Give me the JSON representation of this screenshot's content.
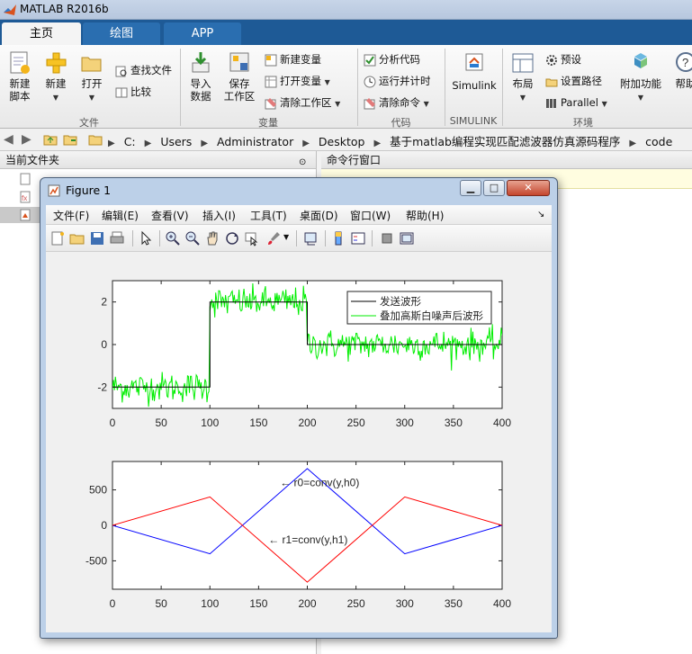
{
  "app": {
    "title": "MATLAB R2016b"
  },
  "tabs": [
    {
      "label": "主页",
      "active": true
    },
    {
      "label": "绘图",
      "active": false
    },
    {
      "label": "APP",
      "active": false
    }
  ],
  "ribbon": {
    "file": {
      "new_script": "新建\n脚本",
      "new": "新建",
      "open": "打开",
      "find_files": "查找文件",
      "compare": "比较",
      "group": "文件"
    },
    "variable": {
      "import": "导入\n数据",
      "save_ws": "保存\n工作区",
      "new_var": "新建变量",
      "open_var": "打开变量",
      "clear_ws": "清除工作区",
      "group": "变量"
    },
    "code": {
      "analyze": "分析代码",
      "run_time": "运行并计时",
      "clear_cmd": "清除命令",
      "group": "代码"
    },
    "simulink": {
      "label": "Simulink",
      "group": "SIMULINK"
    },
    "env": {
      "layout": "布局",
      "prefs": "预设",
      "set_path": "设置路径",
      "parallel": "Parallel",
      "addons": "附加功能",
      "help": "帮助",
      "group": "环境"
    }
  },
  "address": {
    "crumbs": [
      "C:",
      "Users",
      "Administrator",
      "Desktop",
      "基于matlab编程实现匹配滤波器仿真源码程序",
      "code"
    ]
  },
  "panels": {
    "current_folder": "当前文件夹",
    "command_window": "命令行窗口"
  },
  "figure": {
    "title": "Figure 1",
    "menu": [
      "文件(F)",
      "编辑(E)",
      "查看(V)",
      "插入(I)",
      "工具(T)",
      "桌面(D)",
      "窗口(W)",
      "帮助(H)"
    ],
    "colors": {
      "send": "#000000",
      "noisy": "#00ee00",
      "r0": "#0000ff",
      "r1": "#ff0000"
    }
  },
  "chart_data": [
    {
      "type": "line",
      "title": "",
      "xlabel": "",
      "ylabel": "",
      "xlim": [
        0,
        400
      ],
      "ylim": [
        -3,
        3
      ],
      "xticks": [
        0,
        50,
        100,
        150,
        200,
        250,
        300,
        350,
        400
      ],
      "yticks": [
        -2,
        0,
        2
      ],
      "legend": {
        "position": "top-right",
        "entries": [
          "发送波形",
          "叠加高斯白噪声后波形"
        ]
      },
      "series": [
        {
          "name": "发送波形",
          "color": "#000000",
          "x": [
            0,
            100,
            100,
            200,
            200,
            400
          ],
          "y": [
            -2,
            -2,
            2,
            2,
            0,
            0
          ]
        },
        {
          "name": "叠加高斯白噪声后波形",
          "color": "#00ee00",
          "noise_std": 0.35,
          "x": [
            0,
            100,
            100,
            200,
            200,
            400
          ],
          "y": [
            -2,
            -2,
            2,
            2,
            0,
            0
          ]
        }
      ]
    },
    {
      "type": "line",
      "title": "",
      "xlabel": "",
      "ylabel": "",
      "xlim": [
        0,
        400
      ],
      "ylim": [
        -900,
        900
      ],
      "xticks": [
        0,
        50,
        100,
        150,
        200,
        250,
        300,
        350,
        400
      ],
      "yticks": [
        -500,
        0,
        500
      ],
      "annotations": [
        {
          "text": "← r0=conv(y,h0)",
          "x": 172,
          "y": 600
        },
        {
          "text": "← r1=conv(y,h1)",
          "x": 160,
          "y": -200
        }
      ],
      "series": [
        {
          "name": "r0",
          "color": "#0000ff",
          "x": [
            0,
            100,
            200,
            300,
            400
          ],
          "y": [
            0,
            -400,
            800,
            -400,
            0
          ]
        },
        {
          "name": "r1",
          "color": "#ff0000",
          "x": [
            0,
            100,
            200,
            300,
            400
          ],
          "y": [
            0,
            400,
            -800,
            400,
            0
          ]
        }
      ]
    }
  ]
}
